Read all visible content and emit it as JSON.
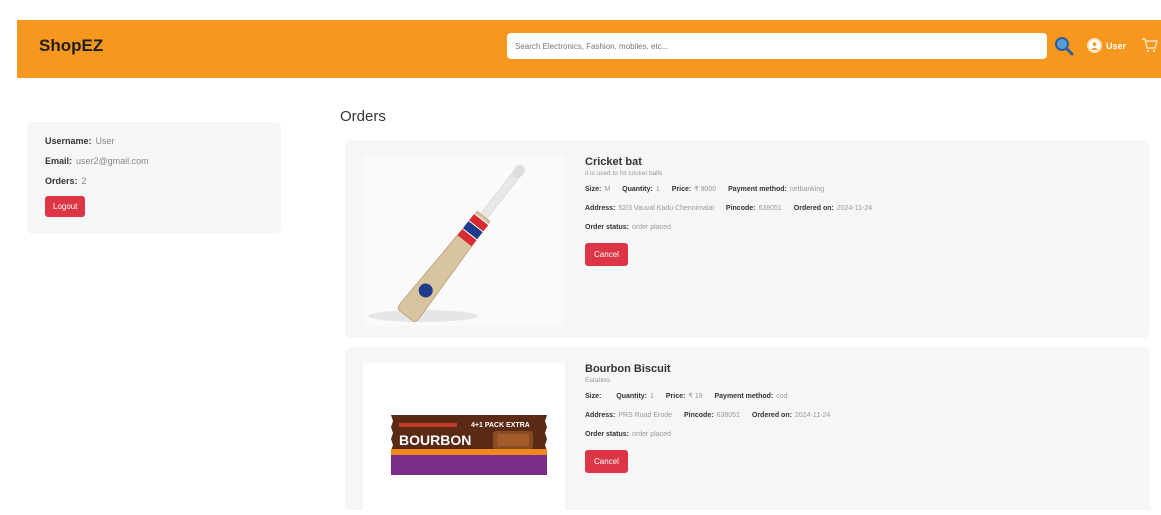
{
  "header": {
    "brand": "ShopEZ",
    "search_placeholder": "Search Electronics, Fashion, mobiles, etc...",
    "user_label": "User"
  },
  "profile": {
    "username_label": "Username:",
    "username": "User",
    "email_label": "Email:",
    "email": "user2@gmail.com",
    "orders_label": "Orders:",
    "orders_count": "2",
    "logout_label": "Logout"
  },
  "orders_title": "Orders",
  "labels": {
    "size": "Size:",
    "quantity": "Quantity:",
    "price": "Price:",
    "payment_method": "Payment method:",
    "address": "Address:",
    "pincode": "Pincode:",
    "ordered_on": "Ordered on:",
    "order_status": "Order status:",
    "cancel": "Cancel"
  },
  "orders": [
    {
      "title": "Cricket bat",
      "description": "it is used to hit cricket balls",
      "size": "M",
      "quantity": "1",
      "price": "₹ 9000",
      "payment_method": "netbanking",
      "address": "52/3 Vauval Kadu Chennimalai",
      "pincode": "638051",
      "ordered_on": "2024-11-24",
      "order_status": "order placed"
    },
    {
      "title": "Bourbon Biscuit",
      "description": "Eatables",
      "size": "",
      "quantity": "1",
      "price": "₹ 19",
      "payment_method": "cod",
      "address": "PRS Road Erode",
      "pincode": "638051",
      "ordered_on": "2024-11-24",
      "order_status": "order placed"
    }
  ],
  "biscuit_pack": {
    "brand_text": "BOURBON",
    "offer_text": "4+1 PACK EXTRA"
  },
  "colors": {
    "navbar": "#f7971e",
    "danger": "#dc3545",
    "card": "#f5f6f7"
  }
}
